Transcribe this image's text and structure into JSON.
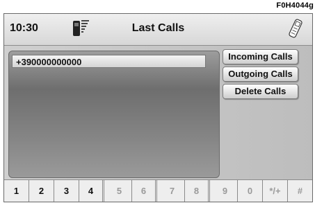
{
  "figure_code": "F0H4044g",
  "status_bar": {
    "time": "10:30",
    "title": "Last Calls",
    "phone_icon": "phone-signal-icon",
    "handset_icon": "handset-icon"
  },
  "calls_list": {
    "items": [
      "+390000000000"
    ]
  },
  "actions": {
    "incoming": "Incoming Calls",
    "outgoing": "Outgoing Calls",
    "delete": "Delete Calls"
  },
  "keypad": {
    "keys": [
      "1",
      "2",
      "3",
      "4",
      "5",
      "6",
      "7",
      "8",
      "9",
      "0",
      "*/+",
      "#"
    ],
    "enabled": [
      true,
      true,
      true,
      true,
      false,
      false,
      false,
      false,
      false,
      false,
      false,
      false
    ]
  },
  "colors": {
    "key_enabled": "#111111",
    "key_disabled": "#9a9a9a"
  }
}
